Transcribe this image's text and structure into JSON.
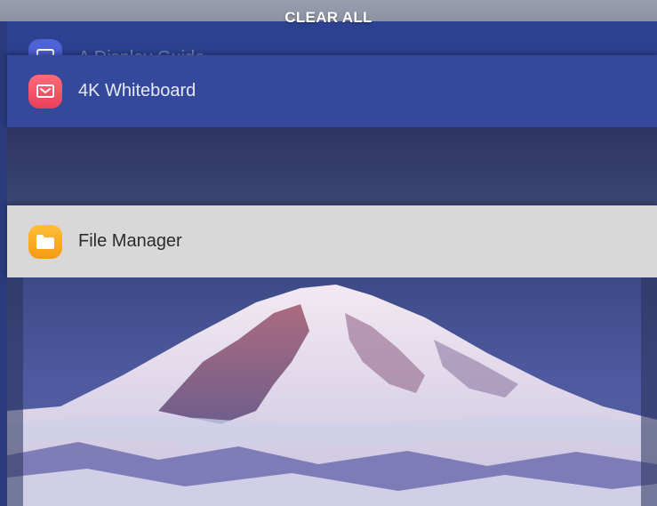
{
  "recents": {
    "clear_all_label": "CLEAR ALL",
    "cards": [
      {
        "label": "A Display Guide",
        "icon": "app-icon"
      },
      {
        "label": "4K Whiteboard",
        "icon": "whiteboard-icon"
      },
      {
        "label": "File Manager",
        "icon": "folder-icon"
      }
    ]
  },
  "wallpaper": {
    "subject": "mountain-icon"
  },
  "colors": {
    "card_blue": "#34499c",
    "card_light": "#d8d8d8",
    "whiteboard_accent": "#e8405a",
    "folder_accent": "#f59a12"
  }
}
